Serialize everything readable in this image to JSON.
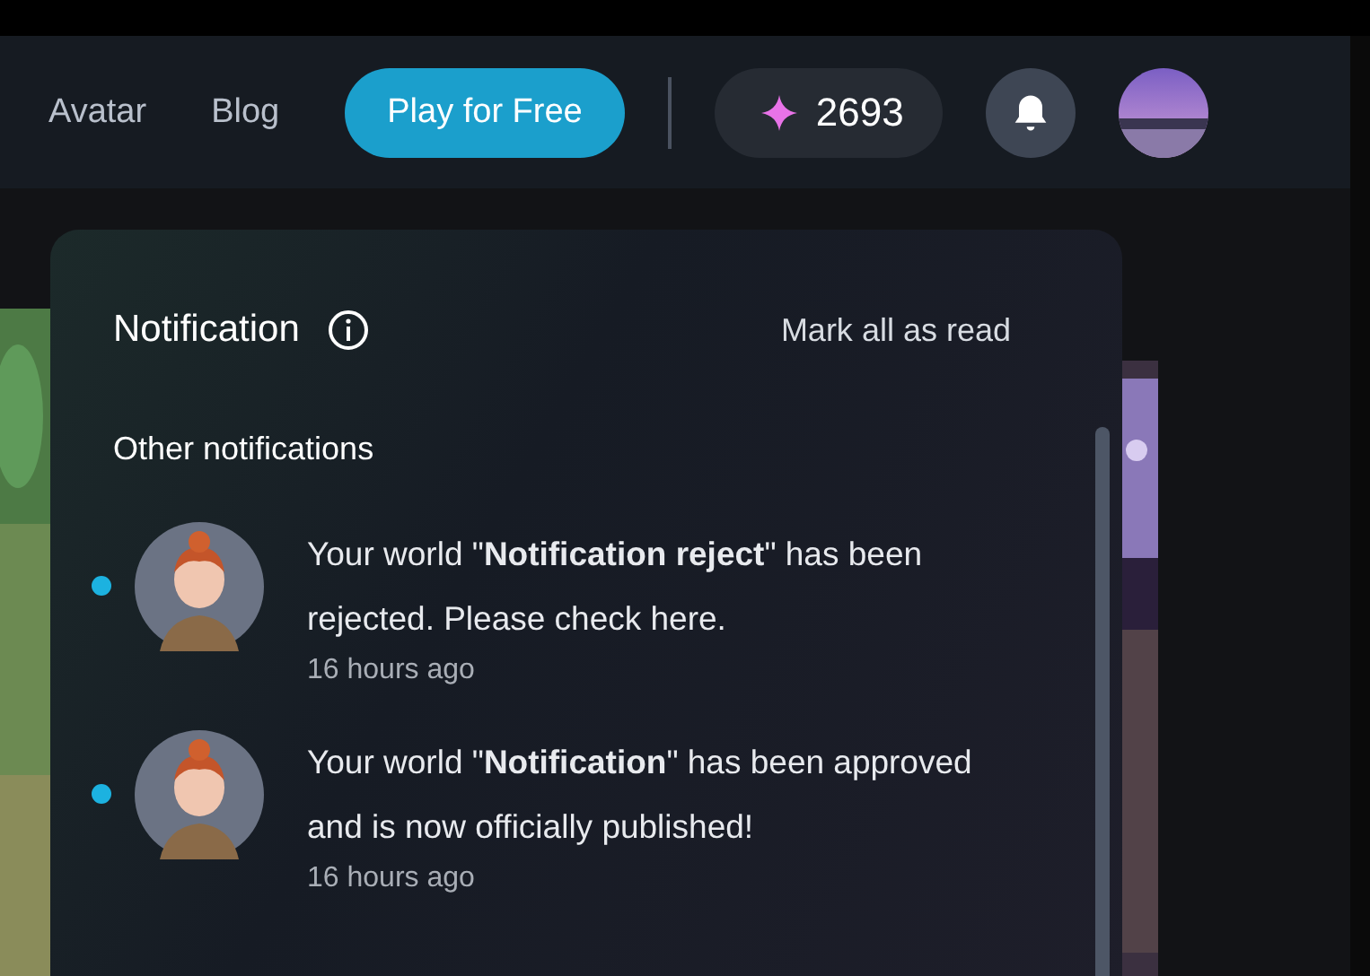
{
  "nav": {
    "links": [
      "Avatar",
      "Blog"
    ],
    "play_button": "Play for Free",
    "points": "2693"
  },
  "notification_panel": {
    "title": "Notification",
    "mark_all": "Mark all as read",
    "section": "Other notifications",
    "items": [
      {
        "text": "Your world \"**Notification reject**\" has been rejected. Please check here.",
        "time": "16 hours ago",
        "unread": true
      },
      {
        "text": "Your world \"**Notification**\" has been approved and is now officially published!",
        "time": "16 hours ago",
        "unread": true
      }
    ]
  }
}
